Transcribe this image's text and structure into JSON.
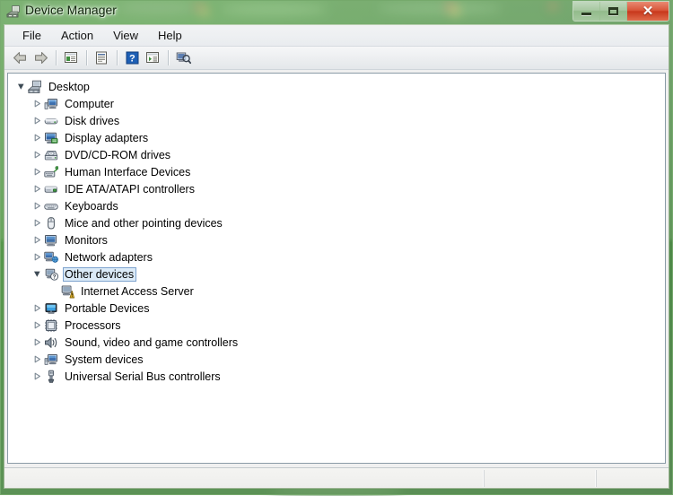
{
  "window": {
    "title": "Device Manager",
    "icon": "device-manager-icon",
    "controls": {
      "minimize_label": "Minimize",
      "maximize_label": "Maximize",
      "close_label": "Close",
      "close_glyph": "✕"
    },
    "frame_color": "#78aa6e",
    "close_button_color": "#c8381c"
  },
  "menubar": {
    "items": [
      {
        "label": "File",
        "name": "menu-file"
      },
      {
        "label": "Action",
        "name": "menu-action"
      },
      {
        "label": "View",
        "name": "menu-view"
      },
      {
        "label": "Help",
        "name": "menu-help"
      }
    ]
  },
  "toolbar": {
    "buttons": [
      {
        "name": "back-button",
        "icon": "back-arrow-icon",
        "tooltip": "Back",
        "enabled": false
      },
      {
        "name": "forward-button",
        "icon": "forward-arrow-icon",
        "tooltip": "Forward",
        "enabled": false
      },
      {
        "name": "show-hide-console-tree-button",
        "icon": "console-tree-icon",
        "tooltip": "Show/Hide Console Tree"
      },
      {
        "name": "properties-button",
        "icon": "properties-icon",
        "tooltip": "Properties"
      },
      {
        "name": "help-button",
        "icon": "help-question-icon",
        "tooltip": "Help"
      },
      {
        "name": "update-driver-button",
        "icon": "update-driver-icon",
        "tooltip": "Update Driver Software"
      },
      {
        "name": "scan-hardware-changes-button",
        "icon": "scan-hardware-icon",
        "tooltip": "Scan for hardware changes"
      }
    ]
  },
  "tree": {
    "root": {
      "label": "Desktop",
      "icon": "desktop-computer-icon",
      "expanded": true,
      "depth": 0
    },
    "nodes": [
      {
        "label": "Computer",
        "icon": "computer-icon",
        "expanded": false,
        "depth": 1,
        "selected": false
      },
      {
        "label": "Disk drives",
        "icon": "disk-drive-icon",
        "expanded": false,
        "depth": 1,
        "selected": false
      },
      {
        "label": "Display adapters",
        "icon": "display-adapter-icon",
        "expanded": false,
        "depth": 1,
        "selected": false
      },
      {
        "label": "DVD/CD-ROM drives",
        "icon": "dvd-drive-icon",
        "expanded": false,
        "depth": 1,
        "selected": false
      },
      {
        "label": "Human Interface Devices",
        "icon": "hid-icon",
        "expanded": false,
        "depth": 1,
        "selected": false
      },
      {
        "label": "IDE ATA/ATAPI controllers",
        "icon": "ide-controller-icon",
        "expanded": false,
        "depth": 1,
        "selected": false
      },
      {
        "label": "Keyboards",
        "icon": "keyboard-icon",
        "expanded": false,
        "depth": 1,
        "selected": false
      },
      {
        "label": "Mice and other pointing devices",
        "icon": "mouse-icon",
        "expanded": false,
        "depth": 1,
        "selected": false
      },
      {
        "label": "Monitors",
        "icon": "monitor-icon",
        "expanded": false,
        "depth": 1,
        "selected": false
      },
      {
        "label": "Network adapters",
        "icon": "network-adapter-icon",
        "expanded": false,
        "depth": 1,
        "selected": false
      },
      {
        "label": "Other devices",
        "icon": "unknown-device-icon",
        "expanded": true,
        "depth": 1,
        "selected": true
      },
      {
        "label": "Internet Access Server",
        "icon": "warning-device-icon",
        "expanded": null,
        "depth": 2,
        "selected": false
      },
      {
        "label": "Portable Devices",
        "icon": "portable-device-icon",
        "expanded": false,
        "depth": 1,
        "selected": false
      },
      {
        "label": "Processors",
        "icon": "processor-icon",
        "expanded": false,
        "depth": 1,
        "selected": false
      },
      {
        "label": "Sound, video and game controllers",
        "icon": "sound-controller-icon",
        "expanded": false,
        "depth": 1,
        "selected": false
      },
      {
        "label": "System devices",
        "icon": "system-device-icon",
        "expanded": false,
        "depth": 1,
        "selected": false
      },
      {
        "label": "Universal Serial Bus controllers",
        "icon": "usb-controller-icon",
        "expanded": false,
        "depth": 1,
        "selected": false
      }
    ]
  },
  "statusbar": {
    "text": "",
    "pane2_text": "",
    "pane3_text": ""
  }
}
